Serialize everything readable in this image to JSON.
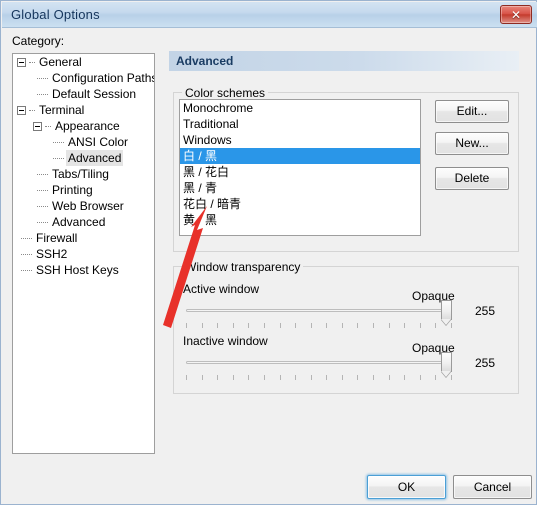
{
  "window": {
    "title": "Global Options",
    "close_icon": "close-icon",
    "close_glyph": "✕"
  },
  "sidebar": {
    "label": "Category:",
    "items": [
      {
        "label": "General",
        "level": 0,
        "expander": true,
        "selected": false
      },
      {
        "label": "Configuration Paths",
        "level": 1,
        "expander": false,
        "selected": false
      },
      {
        "label": "Default Session",
        "level": 1,
        "expander": false,
        "selected": false
      },
      {
        "label": "Terminal",
        "level": 0,
        "expander": true,
        "selected": false
      },
      {
        "label": "Appearance",
        "level": 1,
        "expander": true,
        "selected": false
      },
      {
        "label": "ANSI Color",
        "level": 2,
        "expander": false,
        "selected": false
      },
      {
        "label": "Advanced",
        "level": 2,
        "expander": false,
        "selected": true
      },
      {
        "label": "Tabs/Tiling",
        "level": 1,
        "expander": false,
        "selected": false
      },
      {
        "label": "Printing",
        "level": 1,
        "expander": false,
        "selected": false
      },
      {
        "label": "Web Browser",
        "level": 1,
        "expander": false,
        "selected": false
      },
      {
        "label": "Advanced",
        "level": 1,
        "expander": false,
        "selected": false
      },
      {
        "label": "Firewall",
        "level": 0,
        "expander": false,
        "selected": false
      },
      {
        "label": "SSH2",
        "level": 0,
        "expander": false,
        "selected": false
      },
      {
        "label": "SSH Host Keys",
        "level": 0,
        "expander": false,
        "selected": false
      }
    ]
  },
  "pane": {
    "header": "Advanced"
  },
  "color_schemes": {
    "group_title": "Color schemes",
    "items": [
      {
        "label": "Monochrome",
        "selected": false
      },
      {
        "label": "Traditional",
        "selected": false
      },
      {
        "label": "Windows",
        "selected": false
      },
      {
        "label": "白 / 黑",
        "selected": true
      },
      {
        "label": "黑 / 花白",
        "selected": false
      },
      {
        "label": "黑 / 青",
        "selected": false
      },
      {
        "label": "花白 / 暗青",
        "selected": false
      },
      {
        "label": "黄 / 黑",
        "selected": false
      }
    ],
    "buttons": {
      "edit": "Edit...",
      "new": "New...",
      "delete": "Delete"
    },
    "selection_color": "#2a96e8"
  },
  "transparency": {
    "group_title": "Window transparency",
    "active": {
      "label": "Active window",
      "opaque_label": "Opaque",
      "value": "255",
      "percent": 100
    },
    "inactive": {
      "label": "Inactive window",
      "opaque_label": "Opaque",
      "value": "255",
      "percent": 100
    },
    "tick_count": 18
  },
  "footer": {
    "ok": "OK",
    "cancel": "Cancel"
  },
  "annotation": {
    "type": "red-arrow",
    "color": "#e8312a",
    "points_to": "color-schemes-list"
  }
}
